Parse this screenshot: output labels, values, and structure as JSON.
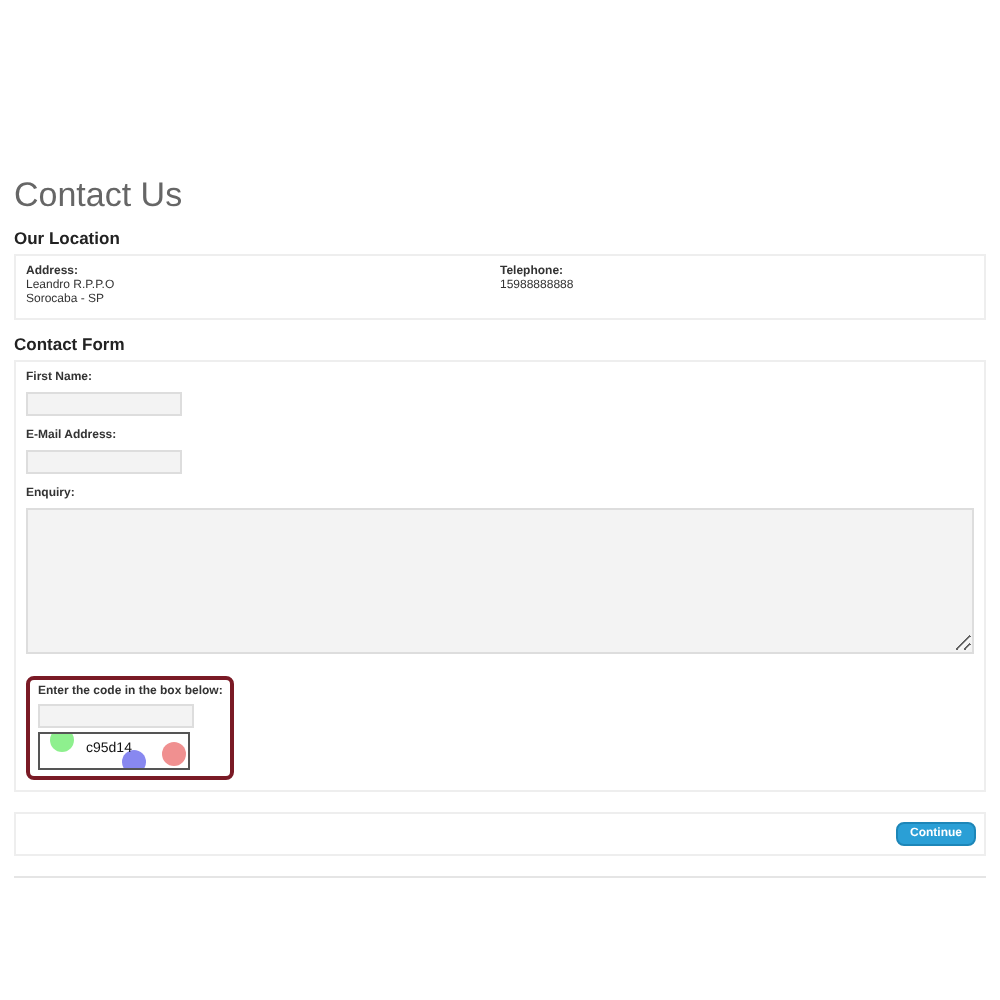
{
  "title": "Contact Us",
  "location": {
    "heading": "Our Location",
    "address_label": "Address:",
    "address_lines": [
      "Leandro R.P.P.O",
      "Sorocaba - SP"
    ],
    "telephone_label": "Telephone:",
    "telephone": "15988888888"
  },
  "form": {
    "heading": "Contact Form",
    "fields": [
      {
        "kind": "input",
        "label": "First Name:"
      },
      {
        "kind": "input",
        "label": "E-Mail Address:"
      },
      {
        "kind": "textarea",
        "label": "Enquiry:"
      }
    ],
    "captcha": {
      "label": "Enter the code in the box below:",
      "code": "c95d14",
      "highlighted": true
    }
  },
  "buttons": [
    "Continue"
  ]
}
